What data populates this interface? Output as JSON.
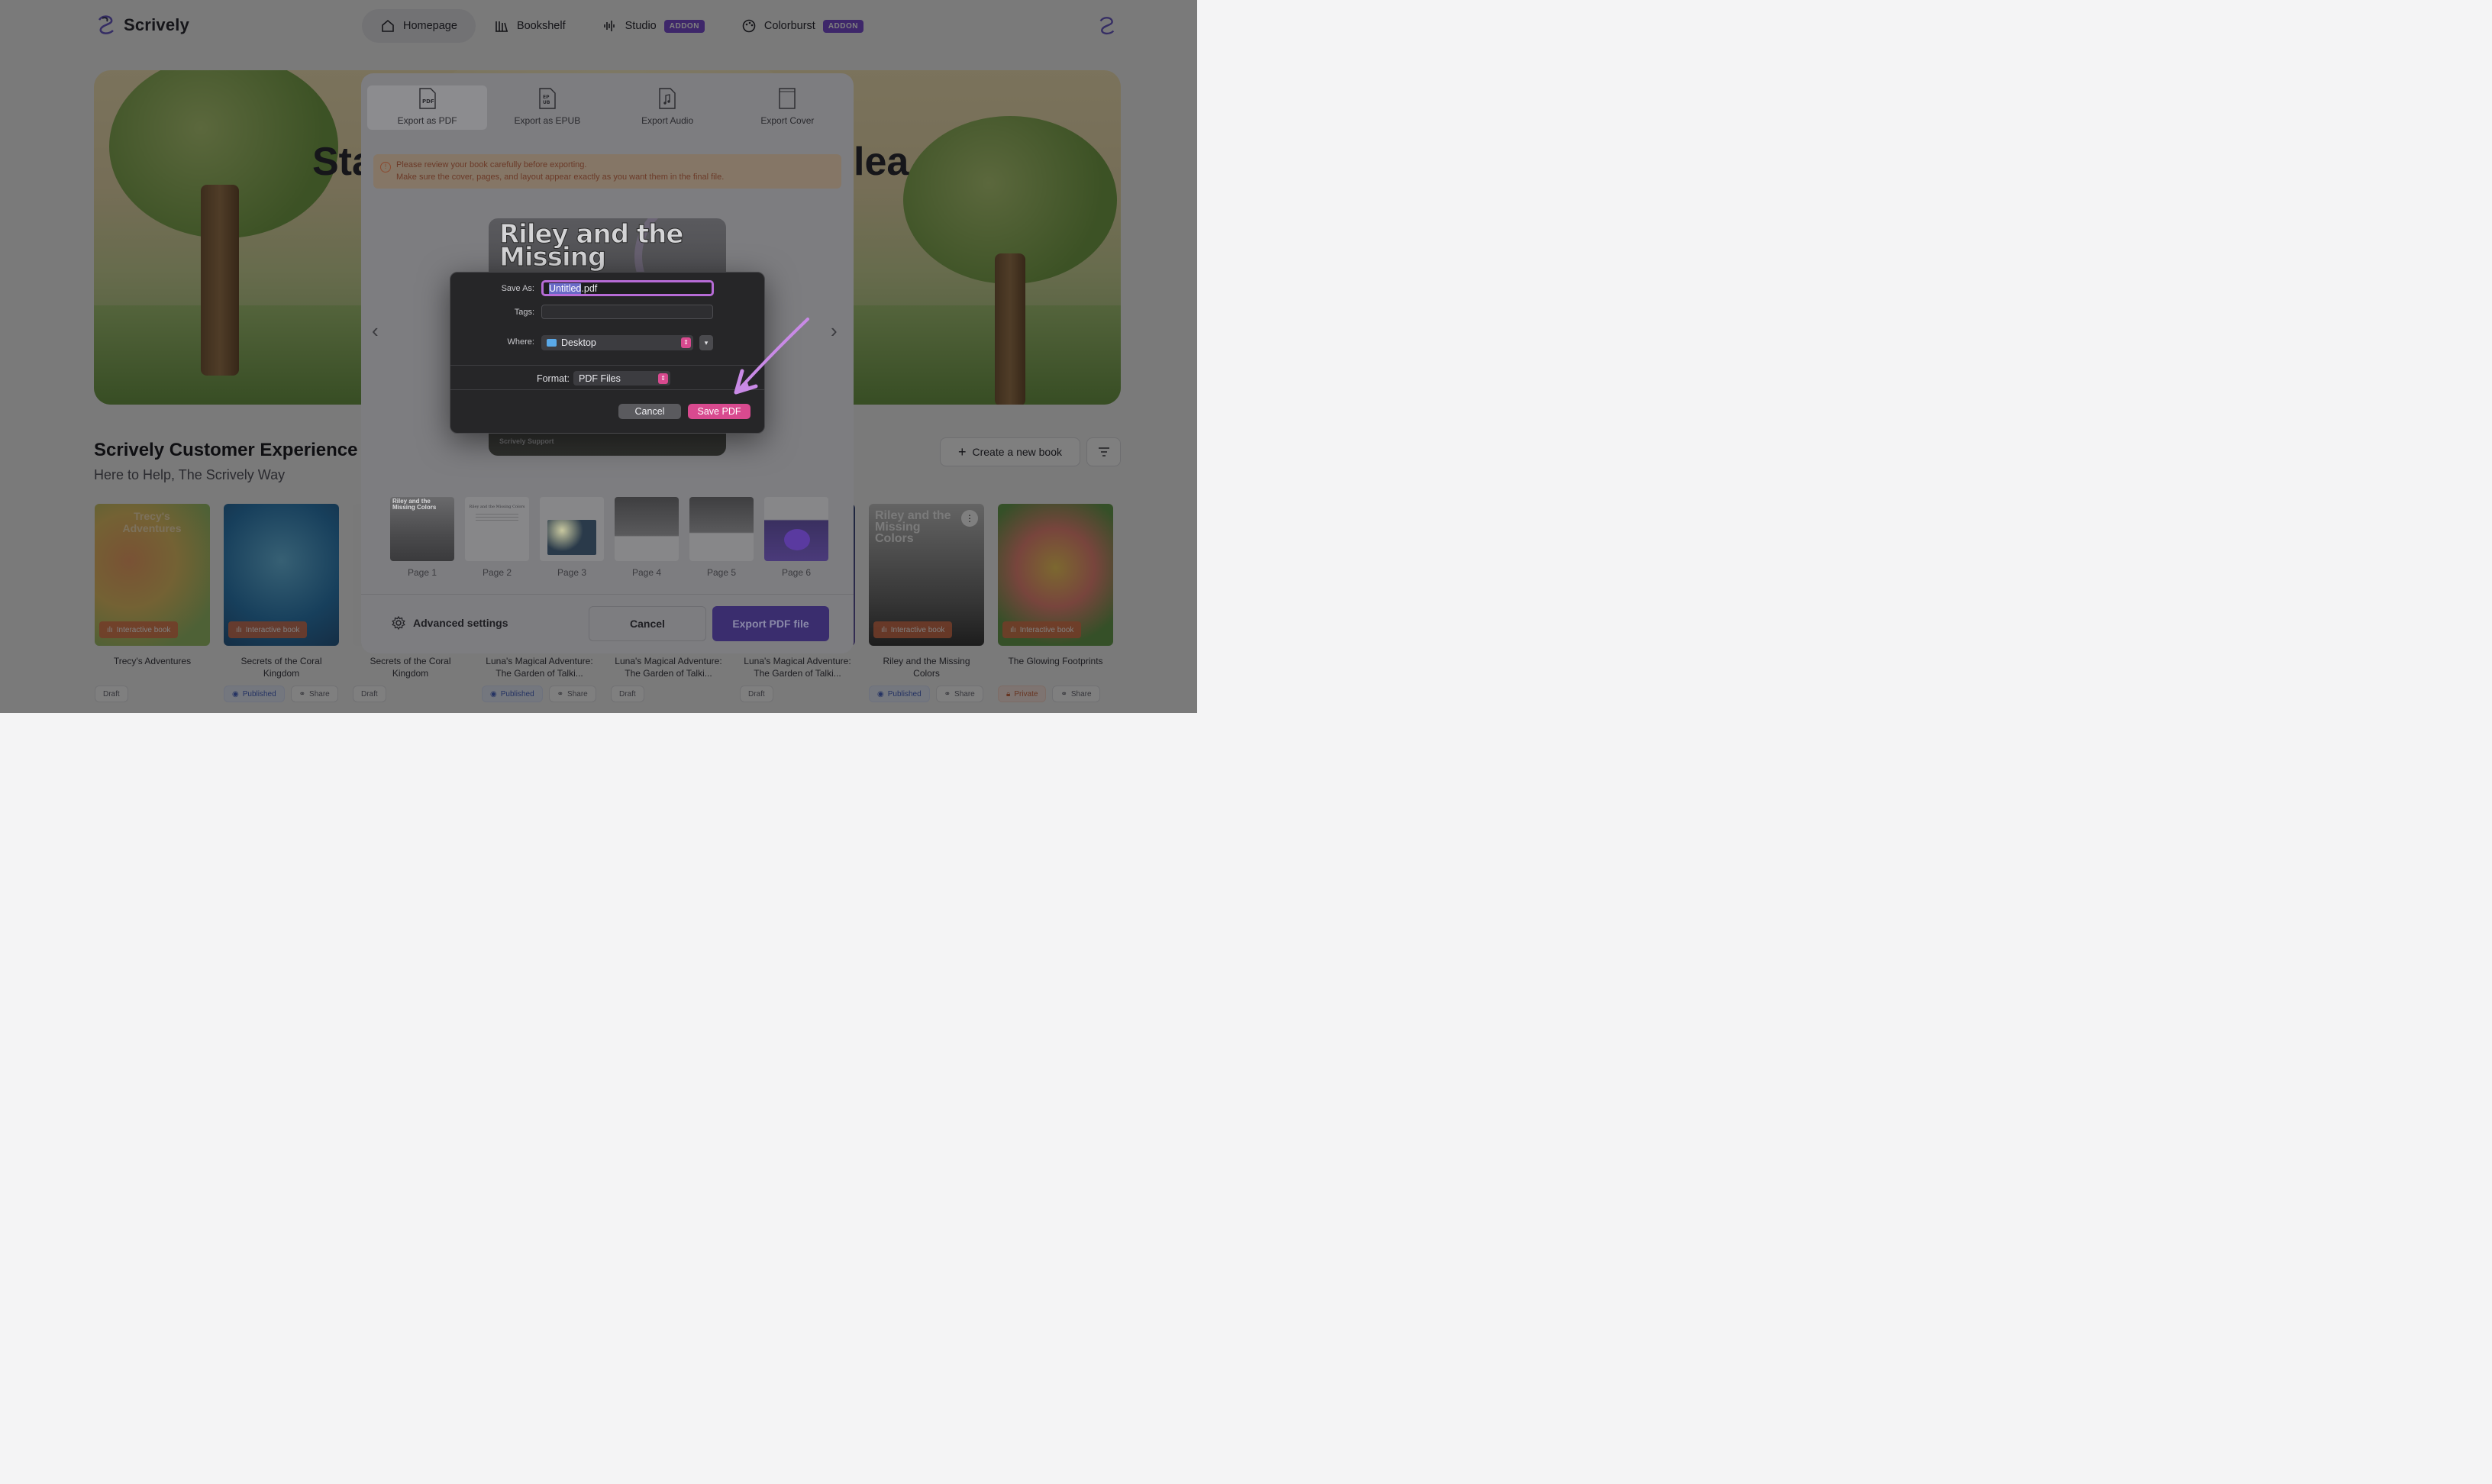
{
  "app": {
    "name": "Scrively"
  },
  "nav": {
    "items": [
      {
        "label": "Homepage",
        "icon": "home-icon",
        "active": true
      },
      {
        "label": "Bookshelf",
        "icon": "bookshelf-icon"
      },
      {
        "label": "Studio",
        "icon": "audio-wave-icon",
        "badge": "ADDON"
      },
      {
        "label": "Colorburst",
        "icon": "palette-icon",
        "badge": "ADDON"
      }
    ]
  },
  "hero": {
    "title_left": "Sta",
    "title_right": "lea"
  },
  "section": {
    "title": "Scrively Customer Experience Te",
    "subtitle": "Here to Help, The Scrively Way",
    "create_label": "Create a new book"
  },
  "books": [
    {
      "title": "Trecy's Adventures",
      "cover_text": "Trecy's Adventures",
      "tag": "Interactive book"
    },
    {
      "title": "Secrets of the Coral Kingdom",
      "tag": "Interactive book"
    },
    {
      "title": "Secrets of the Coral Kingdom"
    },
    {
      "title": "Luna's Magical Adventure: The Garden of Talki..."
    },
    {
      "title": "Luna's Magical Adventure: The Garden of Talki..."
    },
    {
      "title": "Luna's Magical Adventure: The Garden of Talki..."
    },
    {
      "title": "Riley and the Missing Colors",
      "cover_text": "Riley and the Missing Colors",
      "tag": "Interactive book"
    },
    {
      "title": "The Glowing Footprints",
      "tag": "Interactive book"
    }
  ],
  "statuses": {
    "draft": "Draft",
    "published": "Published",
    "share": "Share",
    "private": "Private"
  },
  "export": {
    "tabs": [
      {
        "label": "Export as PDF",
        "icon": "pdf-file-icon",
        "active": true
      },
      {
        "label": "Export as EPUB",
        "icon": "epub-file-icon"
      },
      {
        "label": "Export Audio",
        "icon": "audio-file-icon"
      },
      {
        "label": "Export Cover",
        "icon": "cover-icon"
      }
    ],
    "warning_line1": "Please review your book carefully before exporting.",
    "warning_line2": "Make sure the cover, pages, and layout appear exactly as you want them in the final file.",
    "preview_title": "Riley and the Missing",
    "preview_footer": "Scrively Support",
    "pages": [
      "Page 1",
      "Page 2",
      "Page 3",
      "Page 4",
      "Page 5",
      "Page 6"
    ],
    "page1_title": "Riley and the Missing Colors",
    "page2_title": "Riley and the Missing Colors",
    "advanced_label": "Advanced settings",
    "cancel_label": "Cancel",
    "export_label": "Export PDF file"
  },
  "save_dialog": {
    "save_as_label": "Save As:",
    "filename_selected": "Untitled",
    "filename_ext": ".pdf",
    "tags_label": "Tags:",
    "where_label": "Where:",
    "where_value": "Desktop",
    "format_label": "Format:",
    "format_value": "PDF Files",
    "cancel_label": "Cancel",
    "save_label": "Save PDF"
  },
  "colors": {
    "accent": "#7c4fd4",
    "save_pink": "#d84a8f",
    "highlight_purple": "#b66bd6",
    "export_button": "#3a2d6e"
  }
}
